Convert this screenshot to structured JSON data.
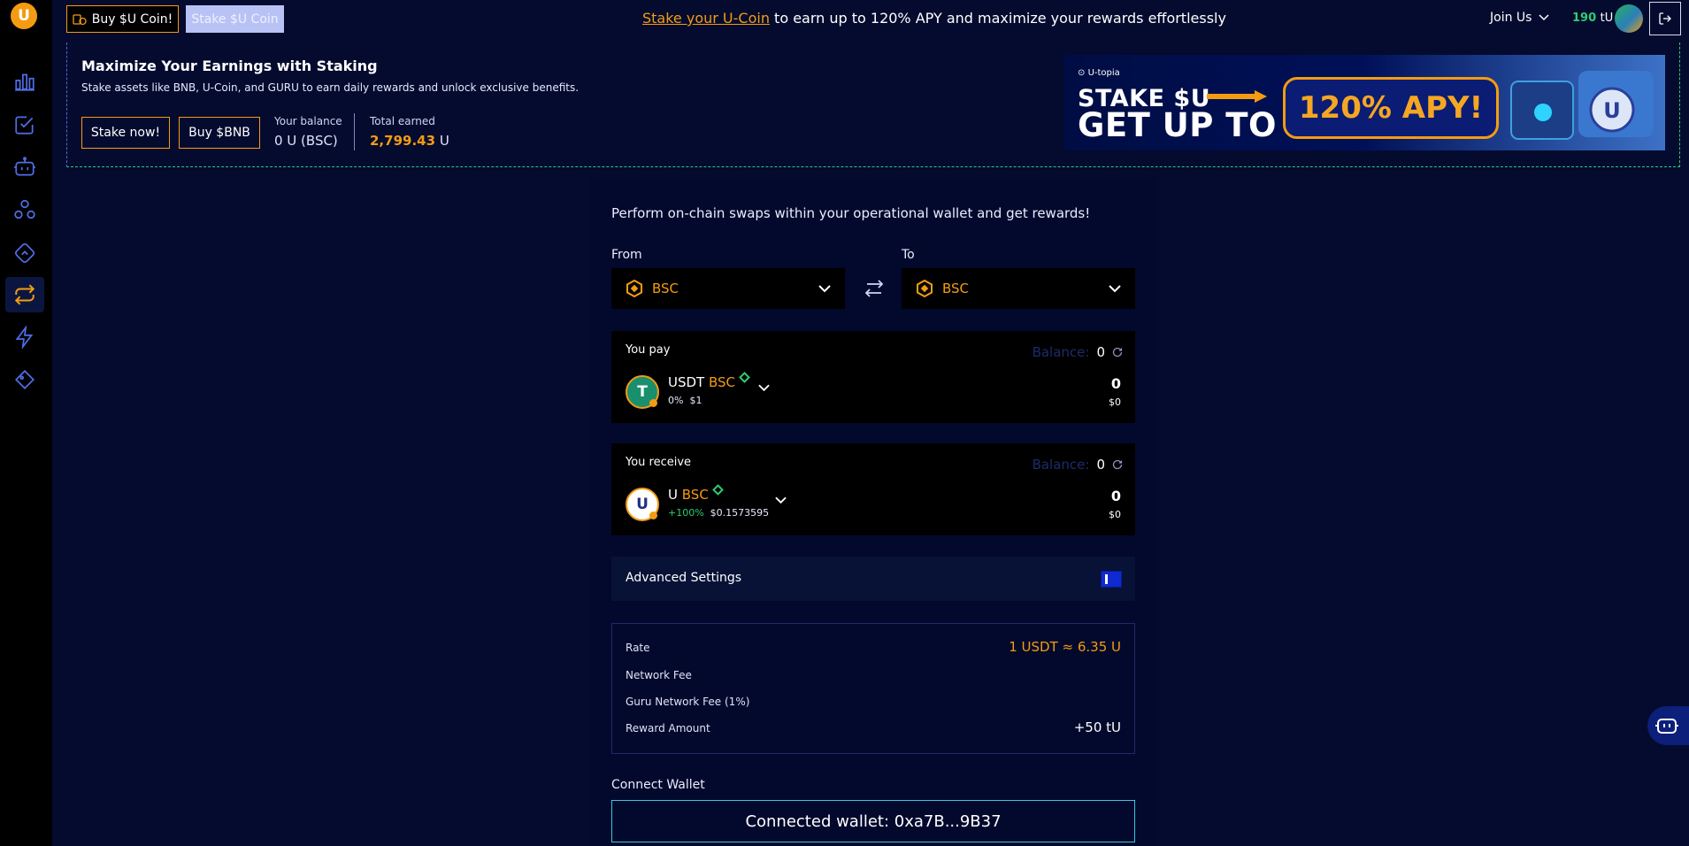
{
  "sidebar": {
    "logo": "U",
    "items": [
      {
        "icon": "bar-chart-icon"
      },
      {
        "icon": "checklist-icon"
      },
      {
        "icon": "robot-icon"
      },
      {
        "icon": "community-icon"
      },
      {
        "icon": "diamond-nav-icon"
      },
      {
        "icon": "swap-icon",
        "active": true
      },
      {
        "icon": "lightning-icon"
      },
      {
        "icon": "gem-icon"
      }
    ]
  },
  "topbar": {
    "buy_label": "Buy $U Coin!",
    "stake_label": "Stake $U Coin",
    "promo_link": "Stake your U-Coin",
    "promo_text": " to earn up to 120% APY and maximize your rewards effortlessly",
    "join_label": "Join Us",
    "tu_value": "190",
    "tu_unit": "tU"
  },
  "banner": {
    "title": "Maximize Your Earnings with Staking",
    "subtitle": "Stake assets like BNB, U-Coin, and GURU to earn daily rewards and unlock exclusive benefits.",
    "stake_now": "Stake now!",
    "buy_bnb": "Buy $BNB",
    "balance_label": "Your balance",
    "balance_value": "0 U (BSC)",
    "earned_label": "Total earned",
    "earned_value": "2,799.43",
    "earned_unit": "U",
    "ad": {
      "brand": "U-topia",
      "line1": "STAKE $U",
      "line2": "GET UP TO",
      "pill": "120% APY!"
    }
  },
  "swap": {
    "description": "Perform on-chain swaps within your operational wallet and get rewards!",
    "from_label": "From",
    "to_label": "To",
    "from_chain": "BSC",
    "to_chain": "BSC",
    "pay": {
      "title": "You pay",
      "balance_label": "Balance:",
      "balance_value": "0",
      "token": "USDT",
      "network": "BSC",
      "change": "0%",
      "price": "$1",
      "amount": "0",
      "usd": "$0"
    },
    "receive": {
      "title": "You receive",
      "balance_label": "Balance:",
      "balance_value": "0",
      "token": "U",
      "network": "BSC",
      "change": "+100%",
      "price": "$0.1573595",
      "amount": "0",
      "usd": "$0"
    },
    "advanced_label": "Advanced Settings",
    "info": {
      "rate_label": "Rate",
      "rate_value": "1 USDT ≈ 6.35 U",
      "network_fee_label": "Network Fee",
      "guru_fee_label": "Guru Network Fee (1%)",
      "reward_label": "Reward Amount",
      "reward_value": "+50 tU"
    },
    "connect_label": "Connect Wallet",
    "connected_text": "Connected wallet: 0xa7B...9B37"
  },
  "colors": {
    "background": "#040b2e",
    "accent": "#f39c12",
    "success": "#2ecc71",
    "panel": "#000000"
  }
}
